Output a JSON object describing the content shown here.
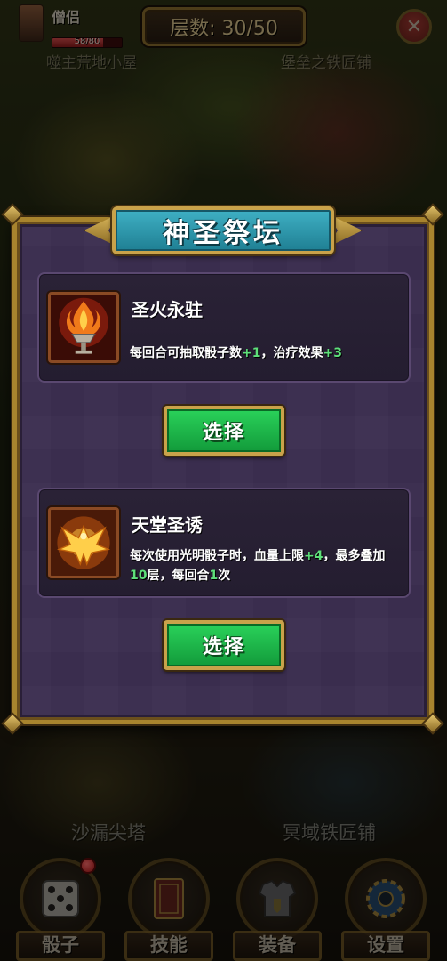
{
  "hud": {
    "hero_name": "僧侣",
    "hp_text": "58/80",
    "hp_fraction": 0.725,
    "floor_label": "层数: 30/50",
    "close_symbol": "✕"
  },
  "map_labels": {
    "top_left": "噬主荒地小屋",
    "top_right": "堡垒之铁匠铺",
    "bottom_left": "沙漏尖塔",
    "bottom_right": "冥域铁匠铺"
  },
  "dialog": {
    "title": "神圣祭坛",
    "options": [
      {
        "title": "圣火永驻",
        "icon": "holy-fire-chalice-icon",
        "desc": [
          {
            "text": "每回合可抽取骰子数",
            "hl": false
          },
          {
            "text": "+1",
            "hl": true
          },
          {
            "text": "，治疗效果",
            "hl": false
          },
          {
            "text": "+3",
            "hl": true
          }
        ],
        "button_label": "选择"
      },
      {
        "title": "天堂圣诱",
        "icon": "phoenix-icon",
        "desc": [
          {
            "text": "每次使用光明骰子时，血量上限",
            "hl": false
          },
          {
            "text": "+4",
            "hl": true
          },
          {
            "text": "，最多叠加",
            "hl": false
          },
          {
            "text": "10",
            "hl": true
          },
          {
            "text": "层，每回合",
            "hl": false
          },
          {
            "text": "1",
            "hl": true
          },
          {
            "text": "次",
            "hl": false
          }
        ],
        "button_label": "选择"
      }
    ]
  },
  "nav": {
    "items": [
      {
        "label": "骰子",
        "icon": "dice-icon",
        "has_notification": true
      },
      {
        "label": "技能",
        "icon": "skill-card-icon",
        "has_notification": false
      },
      {
        "label": "装备",
        "icon": "armor-icon",
        "has_notification": false
      },
      {
        "label": "设置",
        "icon": "settings-gear-icon",
        "has_notification": false
      }
    ]
  },
  "colors": {
    "highlight_green": "#5ee07a",
    "title_plate": "#3fb0c4",
    "button_green": "#2ad25a",
    "panel_purple": "#3a2d4e",
    "gold_border": "#a8842e"
  }
}
